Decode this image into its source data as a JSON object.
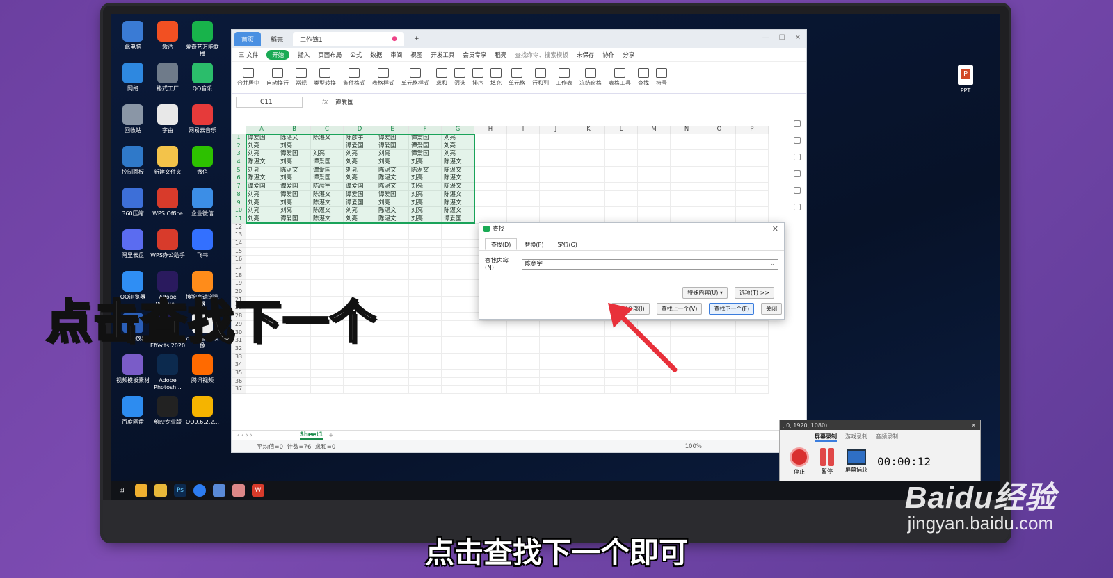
{
  "desktop": {
    "icons": [
      {
        "label": "此电脑",
        "color": "#3a7bd5"
      },
      {
        "label": "激活",
        "color": "#f25022"
      },
      {
        "label": "爱奇艺万能联播",
        "color": "#18b34b"
      },
      {
        "label": "网络",
        "color": "#2e88e0"
      },
      {
        "label": "格式工厂",
        "color": "#6f7b8a"
      },
      {
        "label": "QQ音乐",
        "color": "#2bbd6b"
      },
      {
        "label": "回收站",
        "color": "#8a96a6"
      },
      {
        "label": "字由",
        "color": "#e8e8e8"
      },
      {
        "label": "网易云音乐",
        "color": "#e63a3a"
      },
      {
        "label": "控制面板",
        "color": "#2f79c9"
      },
      {
        "label": "新建文件夹",
        "color": "#f3c34a"
      },
      {
        "label": "微信",
        "color": "#2dc100"
      },
      {
        "label": "360压缩",
        "color": "#3d6fd8"
      },
      {
        "label": "WPS Office",
        "color": "#d83b2b"
      },
      {
        "label": "企业微信",
        "color": "#3c8ee6"
      },
      {
        "label": "阿里云盘",
        "color": "#5b6cf0"
      },
      {
        "label": "WPS办公助手",
        "color": "#d83b2b"
      },
      {
        "label": "飞书",
        "color": "#3370ff"
      },
      {
        "label": "QQ浏览器",
        "color": "#2f8ef4"
      },
      {
        "label": "Adobe Premie...",
        "color": "#2a1a5e"
      },
      {
        "label": "搜狗高速浏览器",
        "color": "#ff8c1a"
      },
      {
        "label": "格式播放器",
        "color": "#2b5fb8"
      },
      {
        "label": "Adobe After Effects 2020",
        "color": "#1f1b4d"
      },
      {
        "label": "oCam屏幕录像",
        "color": "#eeeeee"
      },
      {
        "label": "视频模板素材",
        "color": "#7a5cc8"
      },
      {
        "label": "Adobe Photosh...",
        "color": "#0c2a4e"
      },
      {
        "label": "腾讯视频",
        "color": "#ff6a00"
      },
      {
        "label": "百度网盘",
        "color": "#2d8cf0"
      },
      {
        "label": "剪映专业版",
        "color": "#222222"
      },
      {
        "label": "QQ9.6.2.2...",
        "color": "#f5b400"
      }
    ],
    "right_icon_label": "PPT"
  },
  "wps": {
    "tabs": {
      "home": "首页",
      "draft": "稻壳",
      "workbook": "工作簿1"
    },
    "menu": [
      "三 文件",
      "开始",
      "插入",
      "页面布局",
      "公式",
      "数据",
      "审阅",
      "视图",
      "开发工具",
      "会员专享",
      "稻壳"
    ],
    "menu_search": "查找命令、搜索模板",
    "menu_right": [
      "未保存",
      "协作",
      "分享"
    ],
    "ribbon": [
      "合并居中",
      "自动换行",
      "常规",
      "类型转换",
      "条件格式",
      "表格样式",
      "单元格样式",
      "求和",
      "筛选",
      "排序",
      "填充",
      "单元格",
      "行和列",
      "工作表",
      "冻结窗格",
      "表格工具",
      "查找",
      "符号"
    ],
    "name_box": "C11",
    "fx_label": "fx",
    "formula_value": "谭爱国",
    "columns": [
      "A",
      "B",
      "C",
      "D",
      "E",
      "F",
      "G",
      "H",
      "I",
      "J",
      "K",
      "L",
      "M",
      "N",
      "O",
      "P"
    ],
    "rows_visible": [
      "1",
      "2",
      "3",
      "4",
      "5",
      "6",
      "7",
      "8",
      "9",
      "10",
      "11",
      "12",
      "13",
      "14",
      "15",
      "16",
      "17",
      "18",
      "19",
      "20",
      "21",
      "27",
      "28",
      "29",
      "30",
      "31",
      "32",
      "33",
      "34",
      "35",
      "36",
      "37"
    ],
    "data": [
      [
        "谭爱国",
        "陈湛文",
        "陈湛文",
        "陈彦宇",
        "谭爱国",
        "谭爱国",
        "刘亮"
      ],
      [
        "刘亮",
        "刘亮",
        "",
        "谭爱国",
        "谭爱国",
        "谭爱国",
        "刘亮"
      ],
      [
        "刘亮",
        "谭爱国",
        "刘亮",
        "刘亮",
        "刘亮",
        "谭爱国",
        "刘亮"
      ],
      [
        "陈湛文",
        "刘亮",
        "谭爱国",
        "刘亮",
        "刘亮",
        "刘亮",
        "陈湛文"
      ],
      [
        "刘亮",
        "陈湛文",
        "谭爱国",
        "刘亮",
        "陈湛文",
        "陈湛文",
        "陈湛文"
      ],
      [
        "陈湛文",
        "刘亮",
        "谭爱国",
        "刘亮",
        "陈湛文",
        "刘亮",
        "陈湛文"
      ],
      [
        "谭爱国",
        "谭爱国",
        "陈彦宇",
        "谭爱国",
        "陈湛文",
        "刘亮",
        "陈湛文"
      ],
      [
        "刘亮",
        "谭爱国",
        "陈湛文",
        "谭爱国",
        "谭爱国",
        "刘亮",
        "陈湛文"
      ],
      [
        "刘亮",
        "刘亮",
        "陈湛文",
        "谭爱国",
        "刘亮",
        "刘亮",
        "陈湛文"
      ],
      [
        "刘亮",
        "刘亮",
        "陈湛文",
        "刘亮",
        "陈湛文",
        "刘亮",
        "陈湛文"
      ],
      [
        "刘亮",
        "谭爱国",
        "陈湛文",
        "刘亮",
        "陈湛文",
        "刘亮",
        "谭爱国"
      ]
    ],
    "sheet_tab": "Sheet1",
    "status": {
      "avg": "平均值=0",
      "count": "计数=76",
      "sum": "求和=0",
      "zoom": "100%"
    }
  },
  "find_dialog": {
    "title": "查找",
    "tabs": [
      "查找(D)",
      "替换(P)",
      "定位(G)"
    ],
    "find_label": "查找内容(N):",
    "find_value": "陈彦宇",
    "special_btn": "特殊内容(U) ▾",
    "options_btn": "选项(T) >>",
    "find_all": "查找全部(I)",
    "find_prev": "查找上一个(V)",
    "find_next": "查找下一个(F)",
    "close": "关闭"
  },
  "recorder": {
    "title": ", 0, 1920, 1080)",
    "tabs": [
      "屏幕录制",
      "游戏录制",
      "音频录制"
    ],
    "stop": "停止",
    "pause": "暂停",
    "capture": "屏幕捕获",
    "timer": "00:00:12"
  },
  "overlay_text": "点击查找下一个",
  "caption": "点击查找下一个即可",
  "watermark": {
    "brand": "Baidu经验",
    "url": "jingyan.baidu.com"
  }
}
